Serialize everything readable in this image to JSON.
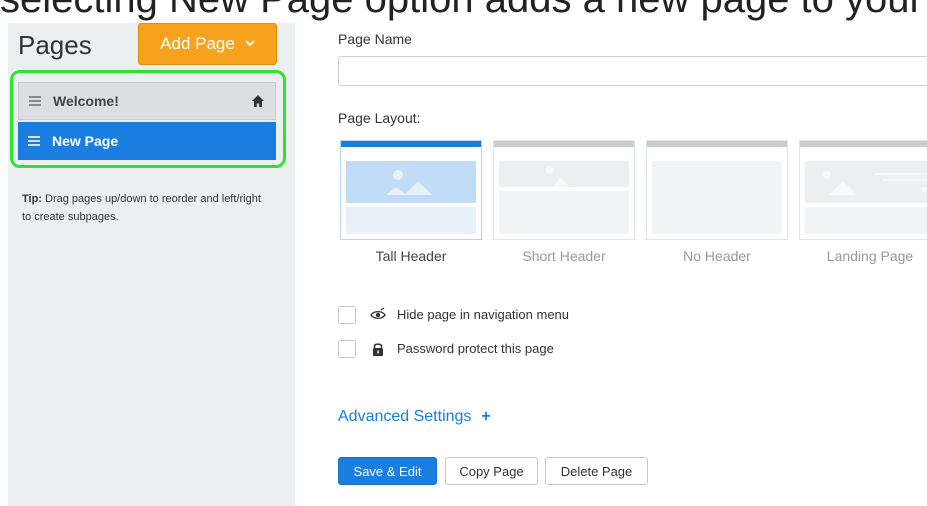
{
  "banner": {
    "text": "selecting New Page option adds a new page to your"
  },
  "sidebar": {
    "title": "Pages",
    "add_button": "Add Page",
    "items": [
      {
        "label": "Welcome!",
        "is_home": true
      },
      {
        "label": "New Page",
        "selected": true
      }
    ],
    "tip_label": "Tip:",
    "tip_text": " Drag pages up/down to reorder and left/right to create subpages."
  },
  "form": {
    "page_name_label": "Page Name",
    "page_name_value": "",
    "layout_label": "Page Layout:",
    "layouts": [
      {
        "name": "Tall Header",
        "selected": true
      },
      {
        "name": "Short Header",
        "selected": false
      },
      {
        "name": "No Header",
        "selected": false
      },
      {
        "name": "Landing Page",
        "selected": false
      }
    ],
    "options": [
      {
        "label": "Hide page in navigation menu",
        "icon": "eye-slash-icon",
        "checked": false
      },
      {
        "label": "Password protect this page",
        "icon": "lock-icon",
        "checked": false
      }
    ],
    "advanced_label": "Advanced Settings",
    "advanced_toggle": "+",
    "buttons": {
      "save": "Save & Edit",
      "copy": "Copy Page",
      "delete": "Delete Page"
    }
  },
  "colors": {
    "accent": "#1a7ee0",
    "add_button": "#f7a21c",
    "highlight": "#2ee52e"
  }
}
